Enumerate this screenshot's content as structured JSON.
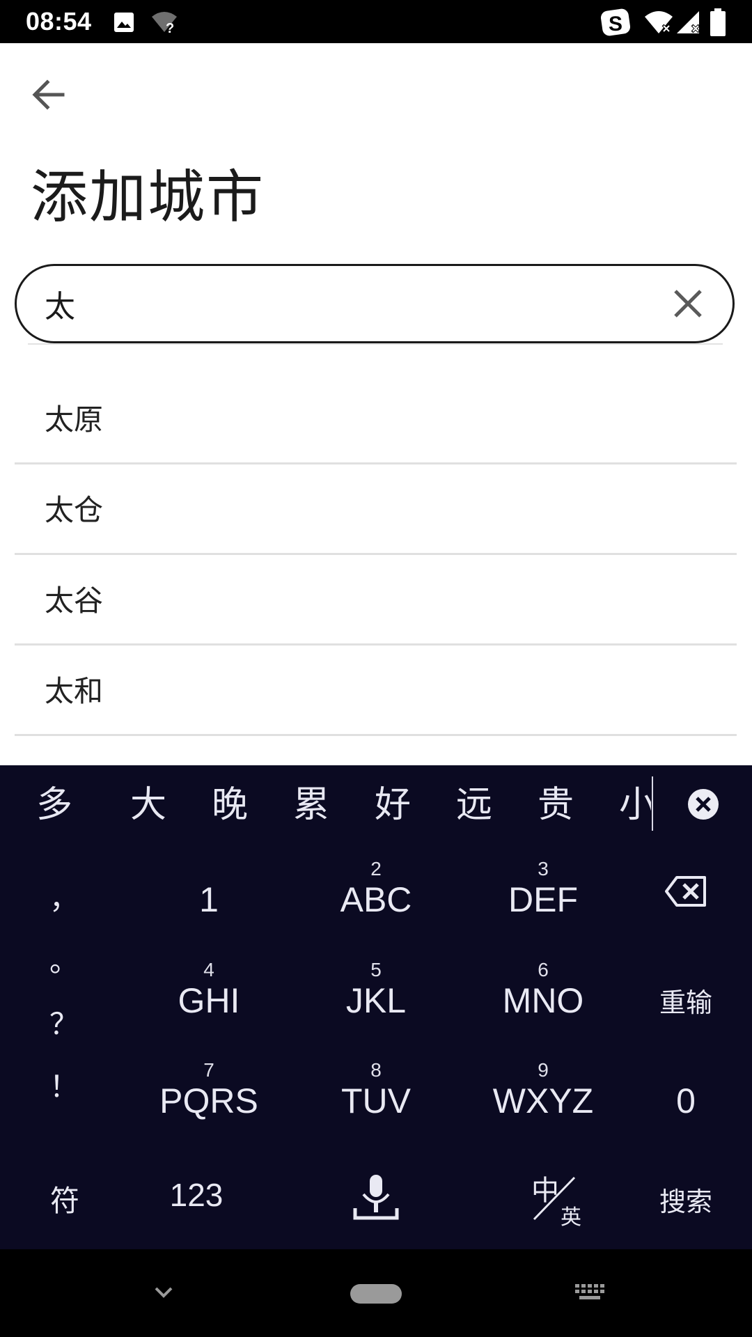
{
  "status_bar": {
    "time": "08:54",
    "icons": [
      "image-icon",
      "wifi-unknown-icon",
      "sogou-input-icon",
      "wifi-off-icon",
      "signal-off-icon",
      "battery-icon"
    ]
  },
  "header": {
    "back_icon": "arrow-left-icon",
    "title": "添加城市"
  },
  "search": {
    "value": "太",
    "clear_icon": "close-icon"
  },
  "results": [
    {
      "label": "太原"
    },
    {
      "label": "太仓"
    },
    {
      "label": "太谷"
    },
    {
      "label": "太和"
    }
  ],
  "keyboard": {
    "candidates": [
      "多",
      "大",
      "晚",
      "累",
      "好",
      "远",
      "贵",
      "小"
    ],
    "candidate_close_icon": "close-circle-icon",
    "punctuation": [
      "，",
      "。",
      "？",
      "！"
    ],
    "row1": [
      {
        "num": "",
        "letters": "1"
      },
      {
        "num": "2",
        "letters": "ABC"
      },
      {
        "num": "3",
        "letters": "DEF"
      }
    ],
    "row2": [
      {
        "num": "4",
        "letters": "GHI"
      },
      {
        "num": "5",
        "letters": "JKL"
      },
      {
        "num": "6",
        "letters": "MNO"
      }
    ],
    "row3": [
      {
        "num": "7",
        "letters": "PQRS"
      },
      {
        "num": "8",
        "letters": "TUV"
      },
      {
        "num": "9",
        "letters": "WXYZ"
      }
    ],
    "backspace_icon": "backspace-icon",
    "reinput_label": "重输",
    "zero_label": "0",
    "symbols_label": "符",
    "numbers_label": "123",
    "mic_icon": "microphone-icon",
    "lang_main": "中",
    "lang_sub": "英",
    "search_label": "搜索"
  },
  "nav_bar": {
    "back_icon": "chevron-down-icon",
    "home_icon": "home-pill-icon",
    "keyboard_icon": "keyboard-icon"
  }
}
